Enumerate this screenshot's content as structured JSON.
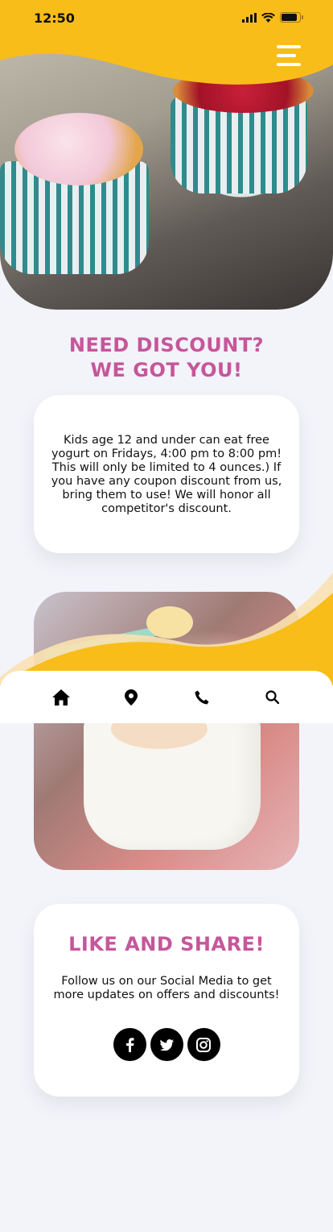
{
  "status_bar": {
    "time": "12:50"
  },
  "hero": {
    "image_alt": "Frozen yogurt cups with toppings"
  },
  "discount": {
    "title_line1": "NEED DISCOUNT?",
    "title_line2": "WE GOT YOU!",
    "body": "Kids age 12 and under can eat free yogurt on Fridays, 4:00 pm to 8:00 pm! This will only be limited to 4 ounces.) If you have any coupon discount from us, bring them to use! We will honor all competitor's discount."
  },
  "nav": {
    "items": [
      {
        "icon": "home-icon"
      },
      {
        "icon": "location-pin-icon"
      },
      {
        "icon": "phone-icon"
      },
      {
        "icon": "search-icon"
      }
    ]
  },
  "share": {
    "title": "LIKE AND SHARE!",
    "body": "Follow us on our Social Media to get more updates on offers and discounts!",
    "networks": [
      "facebook-icon",
      "twitter-icon",
      "instagram-icon"
    ]
  },
  "colors": {
    "accent": "#f9bd19",
    "title": "#c6569a",
    "background": "#f3f3fa"
  }
}
